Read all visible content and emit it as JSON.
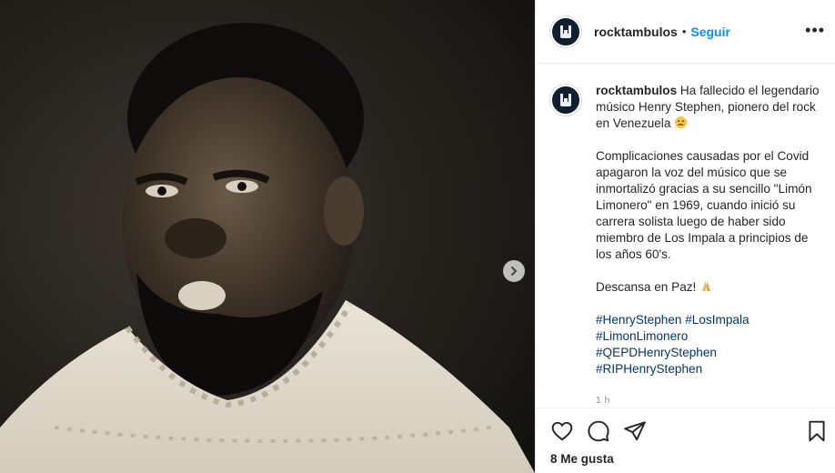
{
  "post": {
    "username": "rocktambulos",
    "separator": "•",
    "follow_label": "Seguir",
    "more_label": "•••",
    "caption": {
      "username": "rocktambulos",
      "intro": "Ha fallecido el legendario músico Henry Stephen, pionero del rock en Venezuela",
      "body": "Complicaciones causadas por el Covid apagaron la voz del músico que se inmortalizó gracias a su sencillo \"Limón Limonero\" en 1969, cuando inició su carrera solista luego de haber sido miembro de Los Impala a principios de los años 60's.",
      "closing": "Descansa en Paz!",
      "hashtags": [
        "#HenryStephen #LosImpala",
        "#LimonLimonero",
        "#QEPDHenryStephen",
        "#RIPHenryStephen"
      ]
    },
    "time_ago": "1 h",
    "likes_label": "8 Me gusta"
  },
  "icons": {
    "avatar": "rock-hand-logo-icon",
    "next": "chevron-right-icon",
    "like": "heart-icon",
    "comment": "comment-icon",
    "share": "paper-plane-icon",
    "save": "bookmark-icon",
    "sad_emoji": "sad-face-emoji-icon",
    "pray_emoji": "folded-hands-emoji-icon"
  },
  "colors": {
    "link": "#0095f6",
    "hashtag": "#00376b",
    "text": "#262626",
    "muted": "#8e8e8e"
  }
}
